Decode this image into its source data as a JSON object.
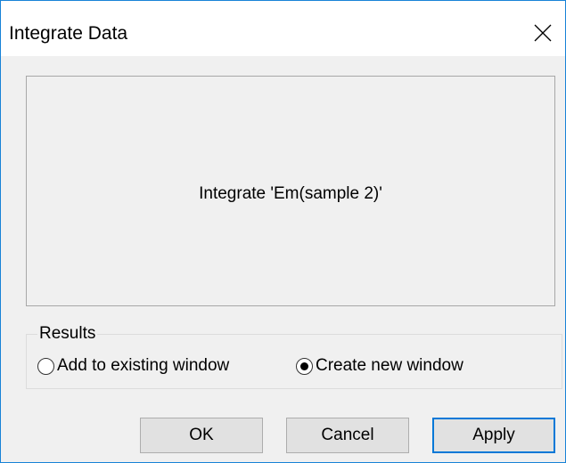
{
  "window": {
    "title": "Integrate Data",
    "close_icon": "close-icon"
  },
  "preview": {
    "text": "Integrate 'Em(sample 2)'"
  },
  "results": {
    "label": "Results",
    "options": [
      {
        "label": "Add to existing window",
        "selected": false
      },
      {
        "label": "Create new window",
        "selected": true
      }
    ]
  },
  "buttons": {
    "ok": "OK",
    "cancel": "Cancel",
    "apply": "Apply"
  },
  "colors": {
    "accent": "#0078d7",
    "dialog_background": "#f0f0f0"
  }
}
